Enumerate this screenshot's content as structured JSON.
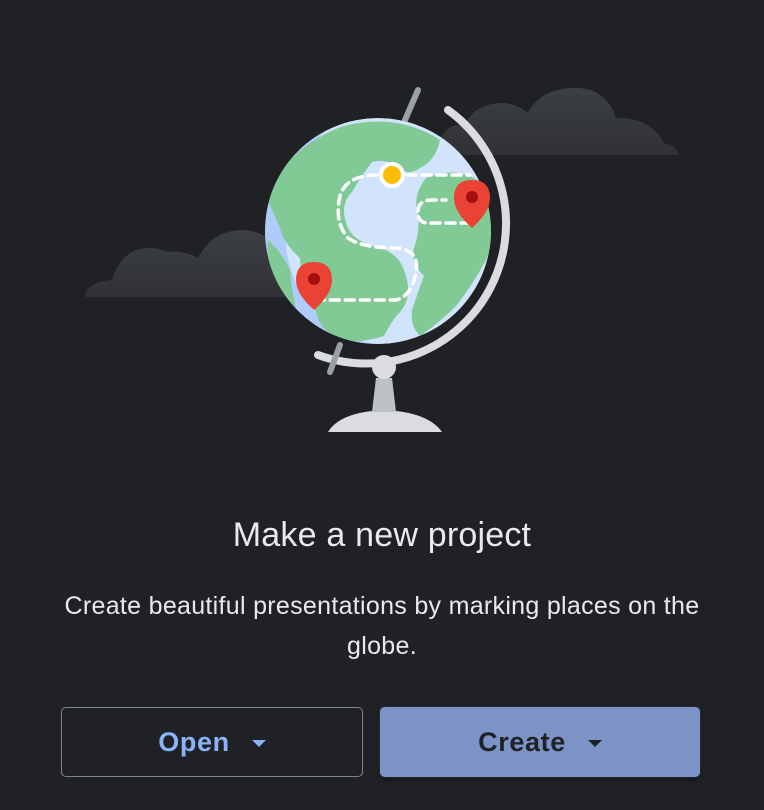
{
  "empty_state": {
    "title": "Make a new project",
    "description": "Create beautiful presentations by marking places on the globe."
  },
  "actions": {
    "open_label": "Open",
    "create_label": "Create"
  },
  "illustration": {
    "name": "globe-illustration",
    "colors": {
      "background": "#202124",
      "ocean": "#d2e3fc",
      "ocean_shadow": "#aecbfa",
      "land": "#81c995",
      "pin": "#ea4335",
      "pin_center": "#a50e0e",
      "start_dot": "#fbbc04",
      "stand": "#dadce0",
      "cloud": "#3c4043"
    }
  }
}
